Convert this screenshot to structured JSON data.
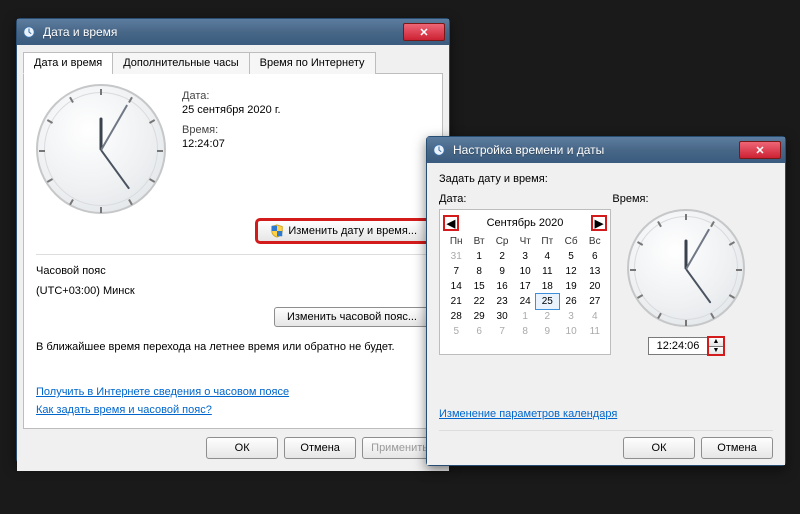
{
  "w1": {
    "title": "Дата и время",
    "tabs": [
      "Дата и время",
      "Дополнительные часы",
      "Время по Интернету"
    ],
    "date_label": "Дата:",
    "date_value": "25 сентября 2020 г.",
    "time_label": "Время:",
    "time_value": "12:24:07",
    "change_dt_btn": "Изменить дату и время...",
    "tz_heading": "Часовой пояс",
    "tz_value": "(UTC+03:00) Минск",
    "change_tz_btn": "Изменить часовой пояс...",
    "dst_msg": "В ближайшее время перехода на летнее время или обратно не будет.",
    "link1": "Получить в Интернете сведения о часовом поясе",
    "link2": "Как задать время и часовой пояс?",
    "ok": "ОК",
    "cancel": "Отмена",
    "apply": "Применить"
  },
  "w2": {
    "title": "Настройка времени и даты",
    "prompt": "Задать дату и время:",
    "date_label": "Дата:",
    "time_label": "Время:",
    "month": "Сентябрь 2020",
    "weekdays": [
      "Пн",
      "Вт",
      "Ср",
      "Чт",
      "Пт",
      "Сб",
      "Вс"
    ],
    "rows": [
      [
        "31",
        "1",
        "2",
        "3",
        "4",
        "5",
        "6"
      ],
      [
        "7",
        "8",
        "9",
        "10",
        "11",
        "12",
        "13"
      ],
      [
        "14",
        "15",
        "16",
        "17",
        "18",
        "19",
        "20"
      ],
      [
        "21",
        "22",
        "23",
        "24",
        "25",
        "26",
        "27"
      ],
      [
        "28",
        "29",
        "30",
        "1",
        "2",
        "3",
        "4"
      ],
      [
        "5",
        "6",
        "7",
        "8",
        "9",
        "10",
        "11"
      ]
    ],
    "selected_day": "25",
    "time_value": "12:24:06",
    "cal_link": "Изменение параметров календаря",
    "ok": "ОК",
    "cancel": "Отмена"
  }
}
